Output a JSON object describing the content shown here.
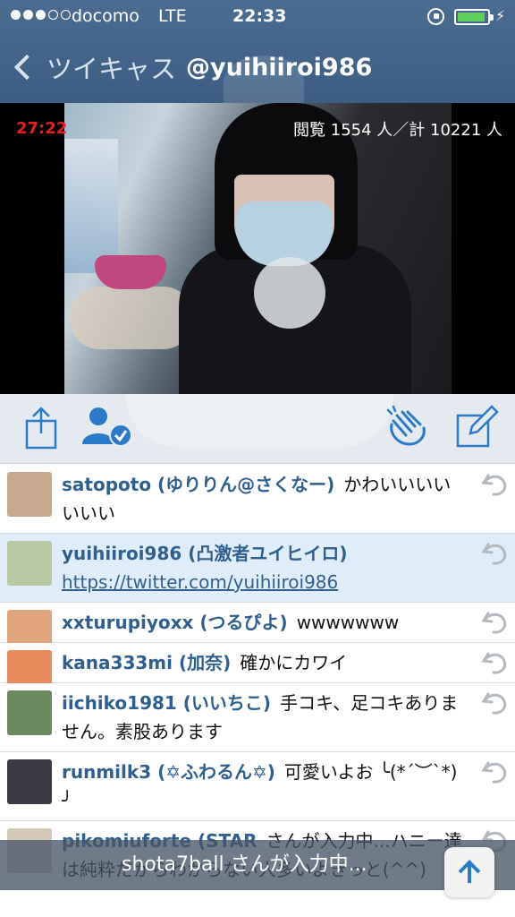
{
  "status_bar": {
    "carrier": "docomo",
    "network": "LTE",
    "time": "22:33"
  },
  "nav": {
    "back_label": "ツイキャス",
    "title": "@yuihiiroi986"
  },
  "video": {
    "timer": "27:22",
    "viewers": "閲覧 1554 人／計 10221 人"
  },
  "toolbar": {
    "icons": [
      "share-icon",
      "follow-icon",
      "clap-icon",
      "edit-icon"
    ]
  },
  "comments": [
    {
      "author": "satopoto (ゆりりん@さくなー)",
      "text": "かわいいいいいいい",
      "link": "",
      "avatar_color": "#c9a98d"
    },
    {
      "author": "yuihiiroi986 (凸激者ユイヒイロ)",
      "text": "",
      "link": "https://twitter.com/yuihiiroi986",
      "avatar_color": "#b8c9a3"
    },
    {
      "author": "xxturupiyoxx (つるぴよ)",
      "text": "wwwwwww",
      "link": "",
      "avatar_color": "#e0a47a"
    },
    {
      "author": "kana333mi (加奈)",
      "text": "確かにカワイ",
      "link": "",
      "avatar_color": "#e88a5c"
    },
    {
      "author": "iichiko1981 (いいちこ)",
      "text": "手コキ、足コキありません。素股あります",
      "link": "",
      "avatar_color": "#6b8a5e"
    },
    {
      "author": "runmilk3 (✡ふわるん✡)",
      "text": "可愛いよお ╰(*´︶`*)╯",
      "link": "",
      "avatar_color": "#3a3a44"
    },
    {
      "author": "pikomiuforte (STAR",
      "text": "さんが入力中...ハニー達は純粋だからわからない人多いよきっと(^^)",
      "link": "",
      "avatar_color": "#d4c8b8"
    }
  ],
  "typing": {
    "text": "shota7ball さんが入力中..."
  }
}
